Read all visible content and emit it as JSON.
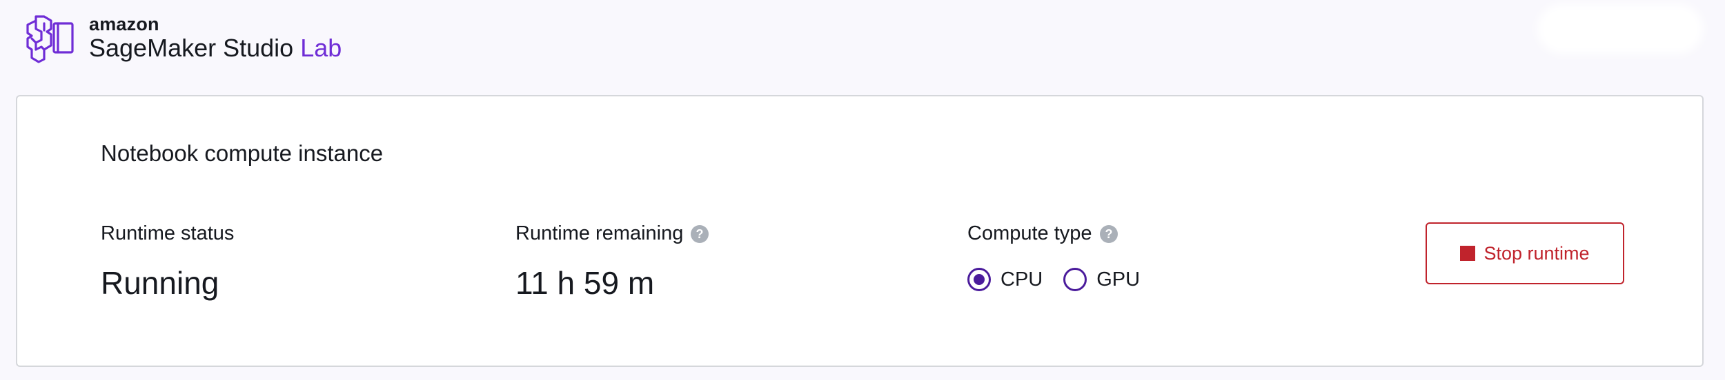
{
  "header": {
    "brand_prefix": "amazon",
    "product_name": "SageMaker Studio",
    "product_suffix": "Lab",
    "logo_icon": "sagemaker-brain-notebook-icon",
    "brand_color": "#6f2dd6"
  },
  "card": {
    "title": "Notebook compute instance",
    "runtime_status": {
      "label": "Runtime status",
      "value": "Running"
    },
    "runtime_remaining": {
      "label": "Runtime remaining",
      "value": "11 h 59 m",
      "help_icon": "question-circle-icon"
    },
    "compute_type": {
      "label": "Compute type",
      "help_icon": "question-circle-icon",
      "options": [
        {
          "label": "CPU",
          "selected": true
        },
        {
          "label": "GPU",
          "selected": false
        }
      ]
    },
    "stop_button": {
      "label": "Stop runtime",
      "icon": "stop-square-icon",
      "color": "#c0232c"
    }
  }
}
